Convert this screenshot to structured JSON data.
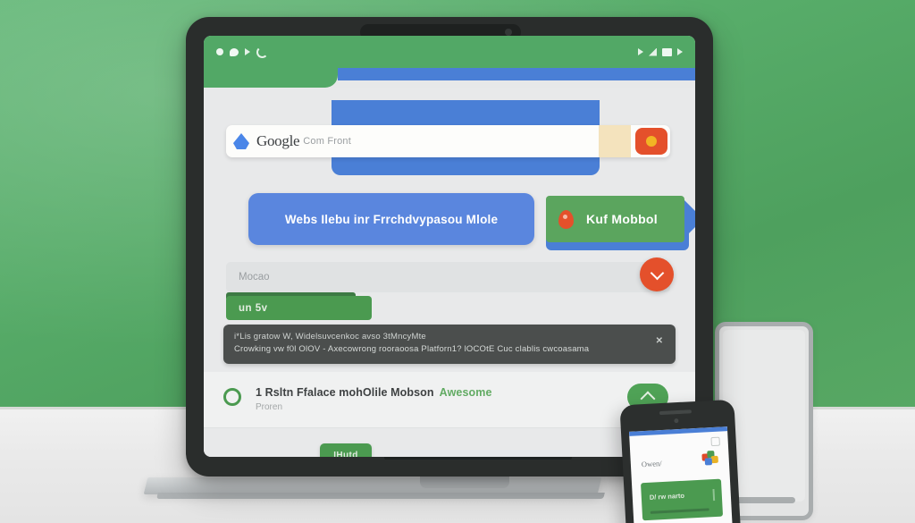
{
  "scene": {
    "title": "Device mockup on desk",
    "background_color": "#57ac69",
    "desk_color": "#eaeaea"
  },
  "tablet": {
    "statusbar": {
      "left_icons": [
        "dot-icon",
        "blob-icon",
        "triangle-icon",
        "arc-icon"
      ],
      "right_icons": [
        "signal-icon",
        "wifi-icon",
        "battery-icon",
        "play-icon"
      ],
      "background_color": "#52a866"
    },
    "search": {
      "brand": "Google",
      "suffix": "Com Front",
      "placeholder": "Com Front",
      "logo_icon": "drop-icon",
      "button_icon": "lens-icon",
      "button_color": "#e4502b"
    },
    "primary_button": {
      "label": "Webs Ilebu inr Frrchdvypasou Mlole",
      "color": "#5a86de"
    },
    "cta_button": {
      "label": "Kuf Mobbol",
      "icon": "map-pin-icon",
      "color": "#5ba55e",
      "arrow_color": "#4a7fd6"
    },
    "input": {
      "value": "",
      "placeholder": "Mocao"
    },
    "fab": {
      "icon": "chevron-down-icon",
      "color": "#e4502b"
    },
    "green_bar": {
      "label": "un 5v",
      "color": "#4b9a50"
    },
    "banner": {
      "line1": "i*Lis gratow W, Widelsuvcenkoc avso 3tMncyMte",
      "line2": "Crowking vw f0l OlOV - Axecowrong rooraoosa Platforn1? lOCOtE Cuc clablis cwcoasama",
      "close_icon": "close-icon",
      "color": "#4b4e4d"
    },
    "result": {
      "status_icon": "circle-ring-icon",
      "title": "1 Rsltn Ffalace mohOlile Mobson",
      "accent": "Awesome",
      "subtitle": "Proren",
      "pill_icon": "chevron-up-icon",
      "pill_color": "#4fa256"
    },
    "bottom_button": {
      "label": "IHutd",
      "color": "#4b9a50"
    }
  },
  "phone": {
    "screen_label": "Owen/",
    "app_icon": "colorful-squares-icon",
    "card_label": "D/ rw narto",
    "card_color": "#4b9a50",
    "topbar_color": "#4a7fd6",
    "home_icon": "home-icon"
  },
  "gray_device": {
    "name": "outline-tablet",
    "border_color": "#a9adae"
  }
}
